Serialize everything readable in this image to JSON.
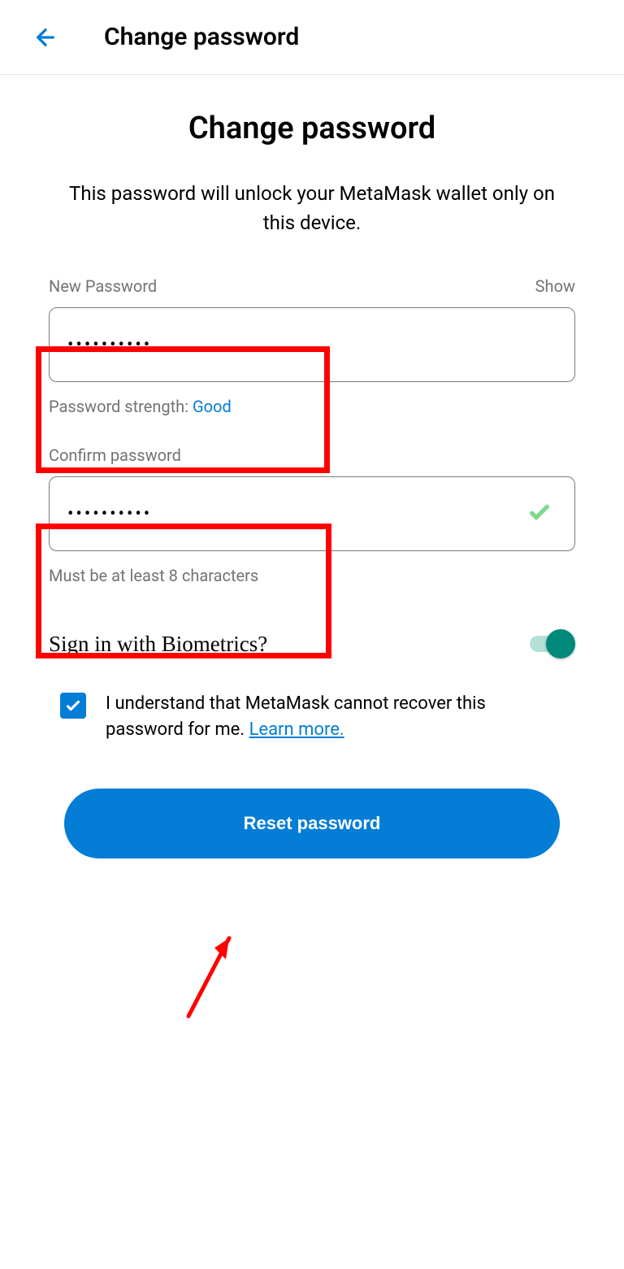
{
  "header": {
    "title": "Change password"
  },
  "page": {
    "title": "Change password",
    "description": "This password will unlock your MetaMask wallet only on this device."
  },
  "newPassword": {
    "label": "New Password",
    "showLabel": "Show",
    "value": "••••••••••",
    "strengthLabel": "Password strength: ",
    "strengthValue": "Good"
  },
  "confirmPassword": {
    "label": "Confirm password",
    "value": "••••••••••",
    "hint": "Must be at least 8 characters"
  },
  "biometrics": {
    "label": "Sign in with Biometrics?",
    "enabled": true
  },
  "acknowledge": {
    "checked": true,
    "text": "I understand that MetaMask cannot recover this password for me. ",
    "learnMore": "Learn more."
  },
  "resetButton": {
    "label": "Reset password"
  },
  "colors": {
    "accent": "#037dd6",
    "toggleThumb": "#00897b",
    "highlight": "#ff0000"
  }
}
